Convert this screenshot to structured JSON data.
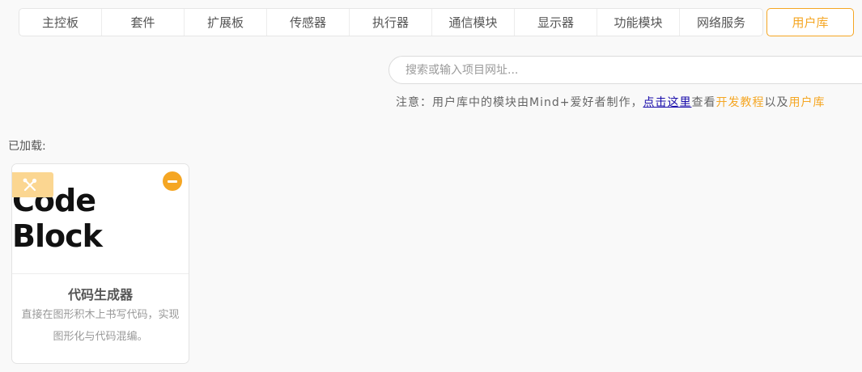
{
  "tabs": [
    {
      "label": "主控板"
    },
    {
      "label": "套件"
    },
    {
      "label": "扩展板"
    },
    {
      "label": "传感器"
    },
    {
      "label": "执行器"
    },
    {
      "label": "通信模块"
    },
    {
      "label": "显示器"
    },
    {
      "label": "功能模块"
    },
    {
      "label": "网络服务"
    }
  ],
  "active_tab": {
    "label": "用户库"
  },
  "search": {
    "placeholder": "搜索或输入项目网址..."
  },
  "notice": {
    "prefix": "注意：用户库中的模块由Mind+爱好者制作，",
    "link": "点击这里",
    "middle": "查看",
    "tutorial": "开发教程",
    "and": "以及",
    "tail": "用户库"
  },
  "loaded": {
    "label": "已加载:"
  },
  "extensions": [
    {
      "logo_text": "Code Block",
      "title": "代码生成器",
      "description": "直接在图形积木上书写代码，实现图形化与代码混编。",
      "badge_icon": "tools-icon",
      "remove_icon": "minus-circle-icon"
    }
  ],
  "colors": {
    "accent": "#f5a623",
    "badge": "#fbd691",
    "link": "#1a0dab"
  }
}
